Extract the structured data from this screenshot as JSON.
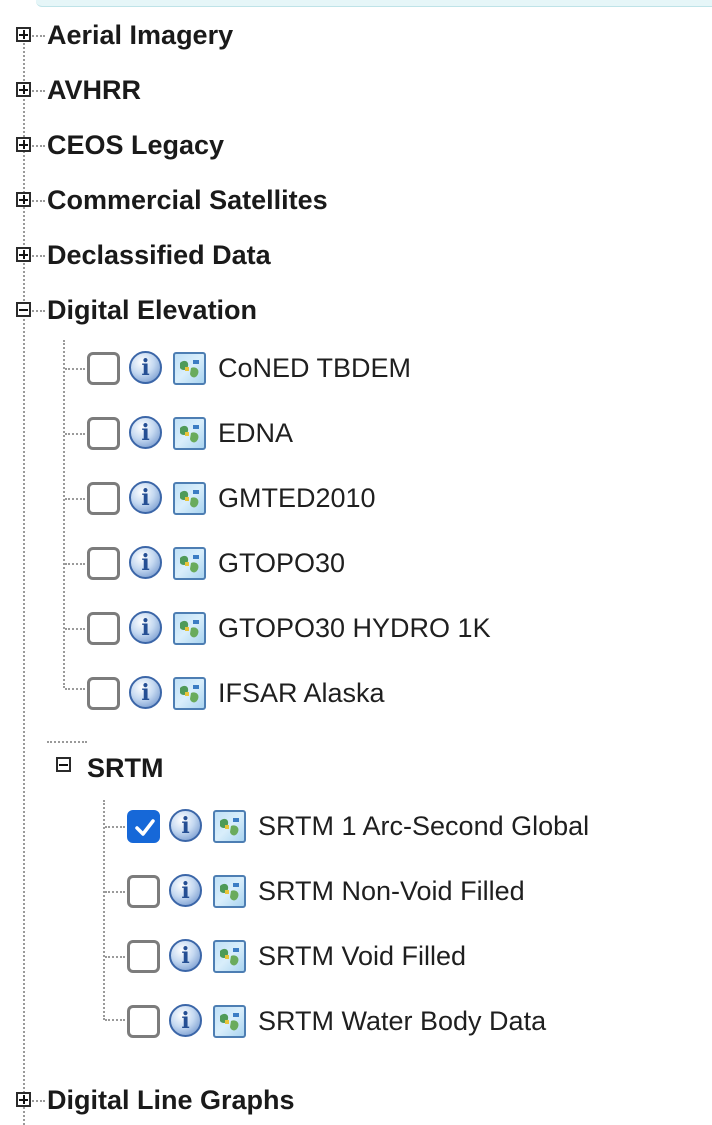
{
  "tree": {
    "categories": [
      {
        "label": "Aerial Imagery",
        "state": "collapsed"
      },
      {
        "label": "AVHRR",
        "state": "collapsed"
      },
      {
        "label": "CEOS Legacy",
        "state": "collapsed"
      },
      {
        "label": "Commercial Satellites",
        "state": "collapsed"
      },
      {
        "label": "Declassified Data",
        "state": "collapsed"
      },
      {
        "label": "Digital Elevation",
        "state": "expanded"
      },
      {
        "label": "Digital Line Graphs",
        "state": "collapsed"
      }
    ],
    "digital_elevation": {
      "datasets": [
        {
          "label": "CoNED TBDEM",
          "checked": false
        },
        {
          "label": "EDNA",
          "checked": false
        },
        {
          "label": "GMTED2010",
          "checked": false
        },
        {
          "label": "GTOPO30",
          "checked": false
        },
        {
          "label": "GTOPO30 HYDRO 1K",
          "checked": false
        },
        {
          "label": "IFSAR Alaska",
          "checked": false
        }
      ],
      "srtm": {
        "label": "SRTM",
        "state": "expanded",
        "datasets": [
          {
            "label": "SRTM 1 Arc-Second Global",
            "checked": true
          },
          {
            "label": "SRTM Non-Void Filled",
            "checked": false
          },
          {
            "label": "SRTM Void Filled",
            "checked": false
          },
          {
            "label": "SRTM Water Body Data",
            "checked": false
          }
        ]
      }
    }
  },
  "icons": {
    "expand": "plus-box-icon",
    "collapse": "minus-box-icon",
    "info": "info-icon",
    "footprint": "map-footprint-icon",
    "check": "checkmark-icon"
  },
  "colors": {
    "checkbox_checked": "#1668d8",
    "info_icon": "#3b66a8",
    "tree_line": "#9a9a9a"
  }
}
